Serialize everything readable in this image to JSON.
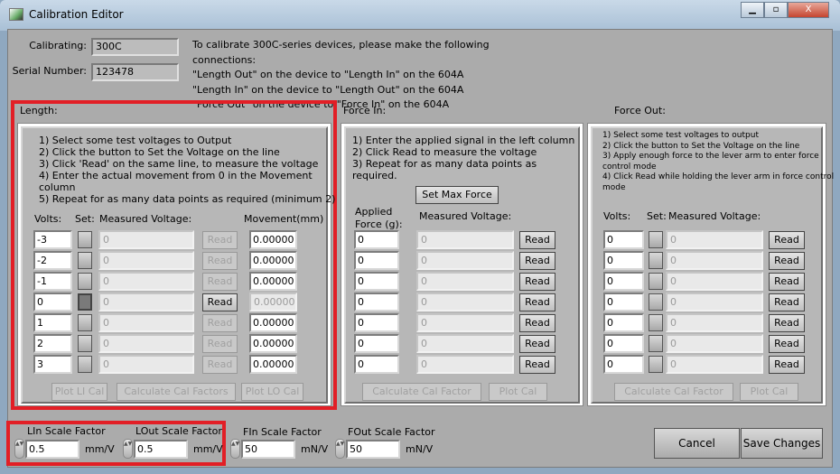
{
  "window": {
    "title": "Calibration Editor",
    "controls": [
      "minimize",
      "maximize",
      "close"
    ]
  },
  "header": {
    "calibrating_label": "Calibrating:",
    "calibrating_value": "300C",
    "serial_label": "Serial Number:",
    "serial_value": "123478",
    "instructions": [
      "To calibrate 300C-series devices, please make the following",
      "connections:",
      "\"Length Out\" on the device to \"Length In\" on the 604A",
      "\"Length In\" on the device to \"Length Out\" on the 604A",
      "\"Force Out\" on the device to \"Force In\" on the 604A"
    ]
  },
  "length": {
    "title": "Length:",
    "instructions": [
      "1) Select some test voltages to Output",
      "2) Click the button to Set the Voltage on the line",
      "3) Click 'Read' on the same line, to measure the voltage",
      "4) Enter the actual movement from 0 in the Movement",
      "column",
      "5) Repeat for as many data points as required (minimum 2)"
    ],
    "headers": {
      "volts": "Volts:",
      "set": "Set:",
      "measured": "Measured Voltage:",
      "movement": "Movement(mm)"
    },
    "rows": [
      {
        "volts": "-3",
        "measured": "0",
        "read": "Read",
        "movement": "0.00000",
        "active": false
      },
      {
        "volts": "-2",
        "measured": "0",
        "read": "Read",
        "movement": "0.00000",
        "active": false
      },
      {
        "volts": "-1",
        "measured": "0",
        "read": "Read",
        "movement": "0.00000",
        "active": false
      },
      {
        "volts": "0",
        "measured": "0",
        "read": "Read",
        "movement": "0.00000",
        "active": true
      },
      {
        "volts": "1",
        "measured": "0",
        "read": "Read",
        "movement": "0.00000",
        "active": false
      },
      {
        "volts": "2",
        "measured": "0",
        "read": "Read",
        "movement": "0.00000",
        "active": false
      },
      {
        "volts": "3",
        "measured": "0",
        "read": "Read",
        "movement": "0.00000",
        "active": false
      }
    ],
    "buttons": {
      "plot_li": "Plot LI Cal",
      "calculate": "Calculate Cal Factors",
      "plot_lo": "Plot LO Cal"
    }
  },
  "force_in": {
    "title": "Force In:",
    "instructions": [
      "1) Enter the applied signal in the left column",
      "2) Click Read to measure the voltage",
      "3) Repeat for as many data points as",
      "required."
    ],
    "set_max_force": "Set Max Force",
    "headers": {
      "applied_1": "Applied",
      "applied_2": "Force (g):",
      "measured": "Measured Voltage:"
    },
    "rows": [
      {
        "applied": "0",
        "measured": "0",
        "read": "Read"
      },
      {
        "applied": "0",
        "measured": "0",
        "read": "Read"
      },
      {
        "applied": "0",
        "measured": "0",
        "read": "Read"
      },
      {
        "applied": "0",
        "measured": "0",
        "read": "Read"
      },
      {
        "applied": "0",
        "measured": "0",
        "read": "Read"
      },
      {
        "applied": "0",
        "measured": "0",
        "read": "Read"
      },
      {
        "applied": "0",
        "measured": "0",
        "read": "Read"
      }
    ],
    "buttons": {
      "calculate": "Calculate Cal Factor",
      "plot": "Plot Cal"
    }
  },
  "force_out": {
    "title": "Force Out:",
    "instructions": [
      "1) Select some test voltages to output",
      "2) Click the button to Set the Voltage on the line",
      "3) Apply enough force to the lever arm to enter force",
      "control mode",
      "4) Click Read while holding the lever arm in force control",
      "mode"
    ],
    "headers": {
      "volts": "Volts:",
      "set": "Set:",
      "measured": "Measured Voltage:"
    },
    "rows": [
      {
        "volts": "0",
        "measured": "0",
        "read": "Read"
      },
      {
        "volts": "0",
        "measured": "0",
        "read": "Read"
      },
      {
        "volts": "0",
        "measured": "0",
        "read": "Read"
      },
      {
        "volts": "0",
        "measured": "0",
        "read": "Read"
      },
      {
        "volts": "0",
        "measured": "0",
        "read": "Read"
      },
      {
        "volts": "0",
        "measured": "0",
        "read": "Read"
      },
      {
        "volts": "0",
        "measured": "0",
        "read": "Read"
      }
    ],
    "buttons": {
      "calculate": "Calculate Cal Factor",
      "plot": "Plot Cal"
    }
  },
  "scale_factors": [
    {
      "label": "LIn Scale Factor",
      "value": "0.5",
      "unit": "mm/V"
    },
    {
      "label": "LOut Scale Factor",
      "value": "0.5",
      "unit": "mm/V"
    },
    {
      "label": "FIn Scale Factor",
      "value": "50",
      "unit": "mN/V"
    },
    {
      "label": "FOut Scale Factor",
      "value": "50",
      "unit": "mN/V"
    }
  ],
  "actions": {
    "cancel": "Cancel",
    "save": "Save Changes"
  },
  "colors": {
    "highlight": "#e21f26",
    "background": "#ababab"
  }
}
